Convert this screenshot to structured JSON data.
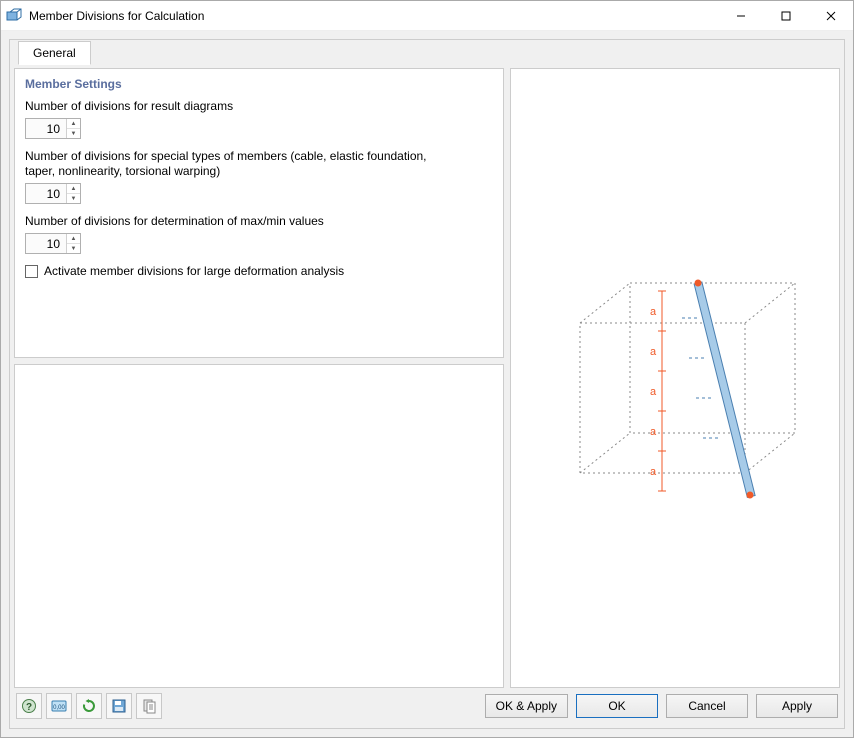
{
  "window": {
    "title": "Member Divisions for Calculation"
  },
  "tabs": {
    "general": "General"
  },
  "member_settings": {
    "heading": "Member Settings",
    "result_diagrams_label": "Number of divisions for result diagrams",
    "result_diagrams_value": "10",
    "special_types_label": "Number of divisions for special types of members (cable, elastic foundation, taper, nonlinearity, torsional warping)",
    "special_types_value": "10",
    "maxmin_label": "Number of divisions for determination of max/min values",
    "maxmin_value": "10",
    "activate_label": "Activate member divisions for large deformation analysis",
    "activate_checked": false
  },
  "footer": {
    "ok_apply": "OK & Apply",
    "ok": "OK",
    "cancel": "Cancel",
    "apply": "Apply"
  },
  "preview": {
    "division_labels": [
      "a",
      "a",
      "a",
      "a",
      "a"
    ]
  }
}
